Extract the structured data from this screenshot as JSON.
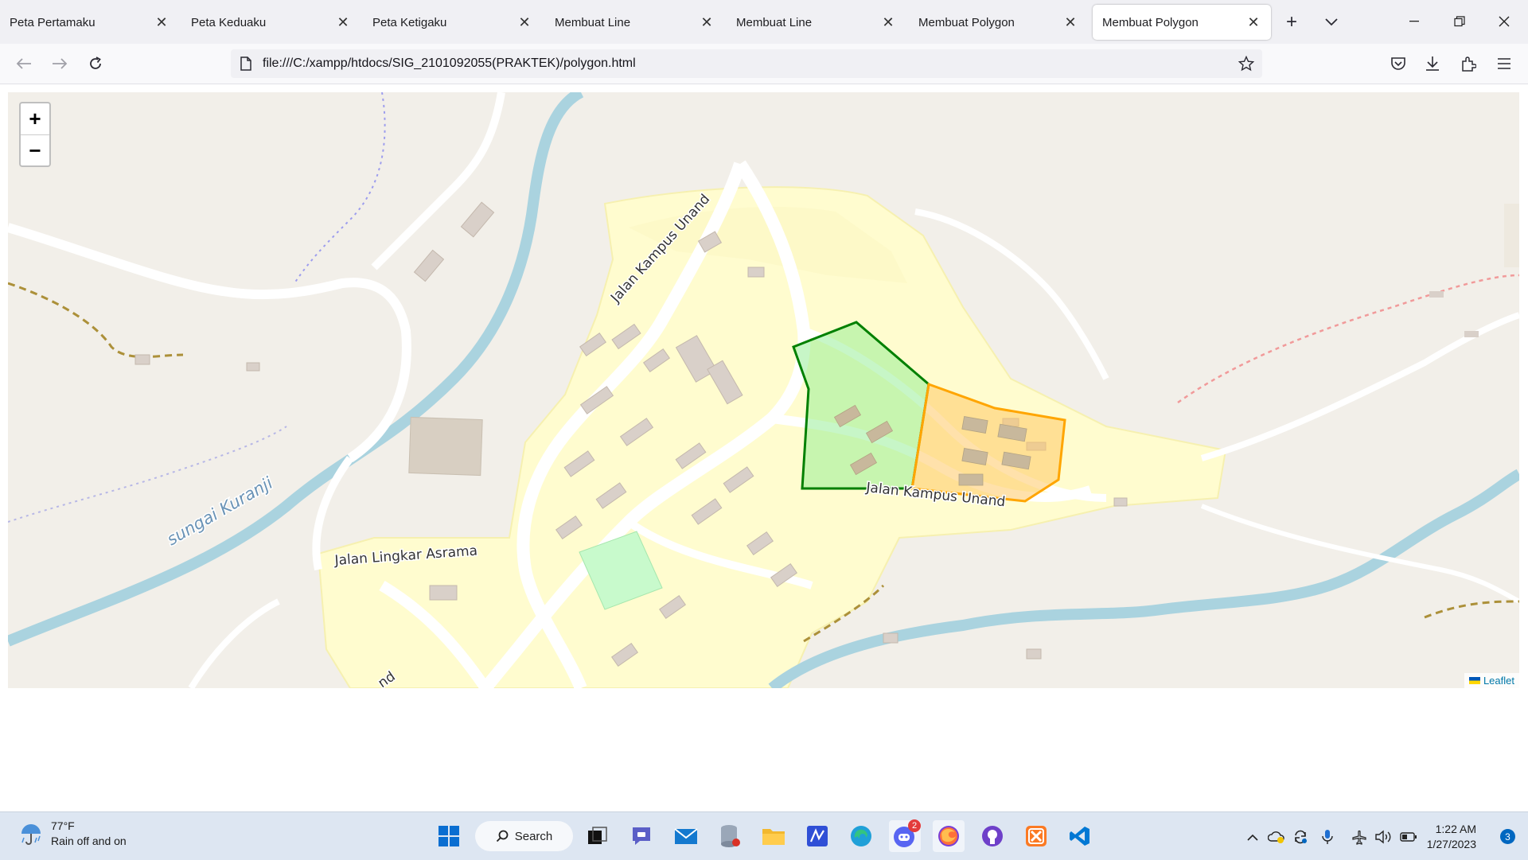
{
  "browser": {
    "tabs": [
      {
        "label": "Peta Pertamaku"
      },
      {
        "label": "Peta Keduaku"
      },
      {
        "label": "Peta Ketigaku"
      },
      {
        "label": "Membuat Line"
      },
      {
        "label": "Membuat Line"
      },
      {
        "label": "Membuat Polygon"
      },
      {
        "label": "Membuat Polygon",
        "active": true
      }
    ],
    "url": "file:///C:/xampp/htdocs/SIG_2101092055(PRAKTEK)/polygon.html"
  },
  "map": {
    "labels": {
      "jalan_kampus_unand_north": "Jalan Kampus Unand",
      "jalan_kampus_unand_south": "Jalan Kampus Unand",
      "jalan_lingkar_asrama": "Jalan Lingkar Asrama",
      "sungai_kuranji": "sungai Kuranji",
      "jalan_bottom_fragment": "nd"
    },
    "zoom_in": "+",
    "zoom_out": "−",
    "attribution": "Leaflet",
    "polygons": [
      {
        "name": "green-polygon",
        "stroke": "#008000",
        "fill": "#90ee90"
      },
      {
        "name": "orange-polygon",
        "stroke": "#ffa500",
        "fill": "#ffc966"
      }
    ]
  },
  "taskbar": {
    "weather_temp": "77°F",
    "weather_desc": "Rain off and on",
    "search_label": "Search",
    "discord_badge": "2",
    "time": "1:22 AM",
    "date": "1/27/2023",
    "notification_count": "3"
  }
}
